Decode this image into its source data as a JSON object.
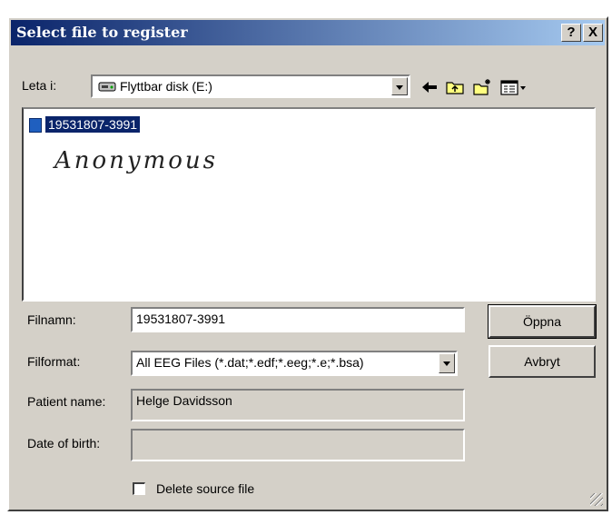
{
  "window": {
    "title": "Select file to register",
    "help_label": "?",
    "close_label": "X"
  },
  "lookin": {
    "label": "Leta i:",
    "value": "Flyttbar disk (E:)"
  },
  "toolbar": {
    "icons": [
      "back-arrow-icon",
      "up-folder-icon",
      "new-folder-icon",
      "view-menu-icon"
    ]
  },
  "filelist": {
    "items": [
      {
        "name": "19531807-3991",
        "selected": true
      }
    ],
    "annotation": "Anonymous"
  },
  "filename": {
    "label": "Filnamn:",
    "value": "19531807-3991"
  },
  "fileformat": {
    "label": "Filformat:",
    "value": "All EEG Files (*.dat;*.edf;*.eeg;*.e;*.bsa)"
  },
  "patient": {
    "name_label": "Patient name:",
    "name_value": "Helge Davidsson",
    "dob_label": "Date of birth:",
    "dob_value": ""
  },
  "buttons": {
    "open": "Öppna",
    "cancel": "Avbryt"
  },
  "delete_source": {
    "label": "Delete source file",
    "checked": false
  },
  "colors": {
    "title_start": "#0a246a",
    "title_end": "#a6caf0",
    "selection": "#0a246a",
    "face": "#d4d0c8"
  }
}
